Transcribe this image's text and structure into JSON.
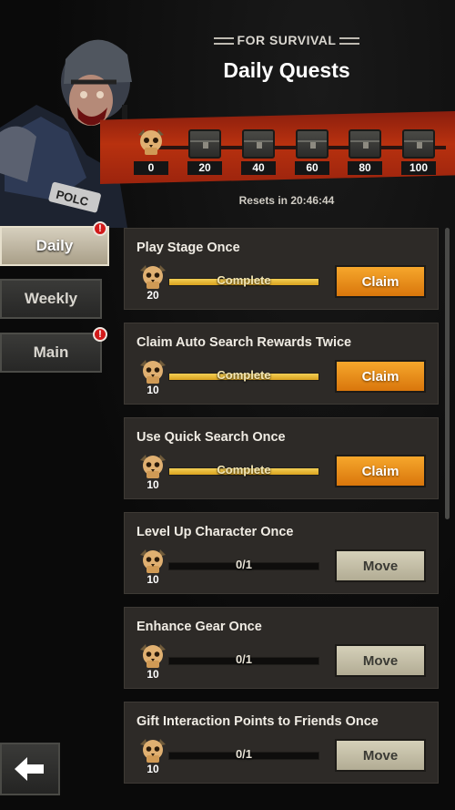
{
  "header": {
    "subtitle": "FOR SURVIVAL",
    "title": "Daily Quests"
  },
  "track": {
    "milestones": [
      {
        "value": "0",
        "icon": "skull-icon"
      },
      {
        "value": "20",
        "icon": "chest-icon"
      },
      {
        "value": "40",
        "icon": "chest-icon"
      },
      {
        "value": "60",
        "icon": "chest-icon"
      },
      {
        "value": "80",
        "icon": "chest-icon"
      },
      {
        "value": "100",
        "icon": "chest-icon"
      }
    ],
    "reset_text": "Resets in 20:46:44"
  },
  "tabs": [
    {
      "label": "Daily",
      "active": true,
      "badge": "!"
    },
    {
      "label": "Weekly",
      "active": false
    },
    {
      "label": "Main",
      "active": false,
      "badge": "!"
    }
  ],
  "quests": [
    {
      "title": "Play Stage Once",
      "points": "20",
      "progress_text": "Complete",
      "progress": 1.0,
      "button": "Claim"
    },
    {
      "title": "Claim Auto Search Rewards Twice",
      "points": "10",
      "progress_text": "Complete",
      "progress": 1.0,
      "button": "Claim"
    },
    {
      "title": "Use Quick Search Once",
      "points": "10",
      "progress_text": "Complete",
      "progress": 1.0,
      "button": "Claim"
    },
    {
      "title": "Level Up Character Once",
      "points": "10",
      "progress_text": "0/1",
      "progress": 0.0,
      "button": "Move"
    },
    {
      "title": "Enhance Gear Once",
      "points": "10",
      "progress_text": "0/1",
      "progress": 0.0,
      "button": "Move"
    },
    {
      "title": "Gift Interaction Points to Friends Once",
      "points": "10",
      "progress_text": "0/1",
      "progress": 0.0,
      "button": "Move"
    }
  ],
  "colors": {
    "claim": "#e98b17",
    "move": "#c6c0a8",
    "progress": "#e8b232",
    "banner": "#b8310f",
    "badge": "#d11a1a"
  },
  "icons": {
    "back": "back-arrow-icon",
    "points": "skull-icon"
  }
}
